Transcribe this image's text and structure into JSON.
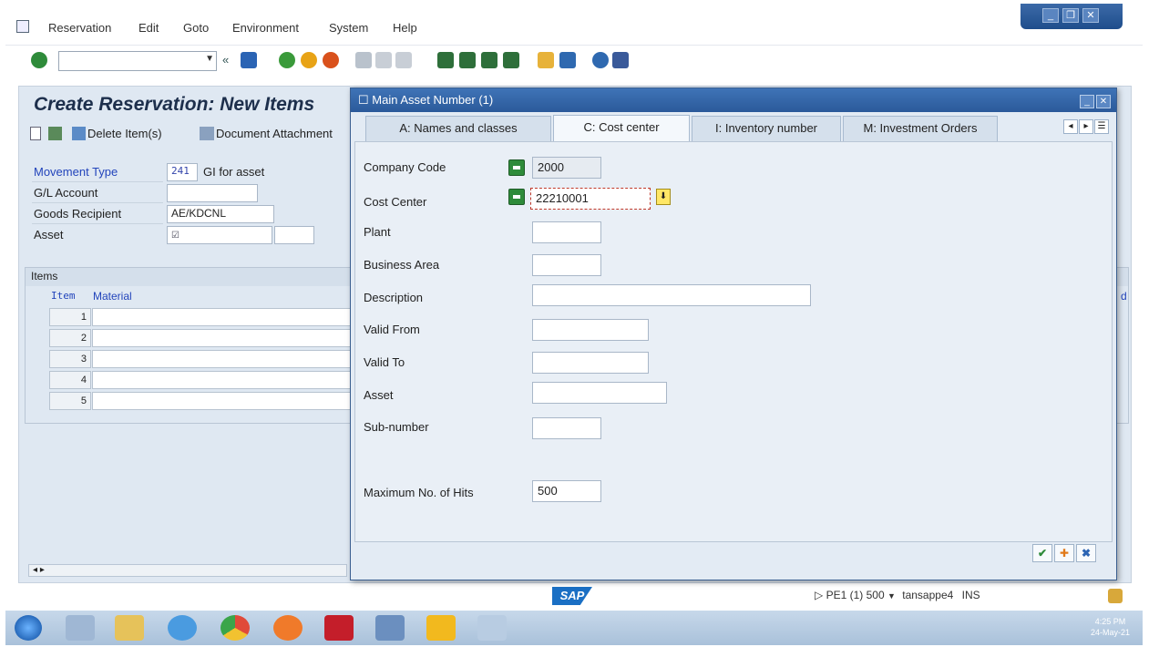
{
  "menubar": {
    "items": [
      "Reservation",
      "Edit",
      "Goto",
      "Environment",
      "System",
      "Help"
    ]
  },
  "toolbar": {
    "command_value": "",
    "icons": [
      "enter-icon",
      "save-icon",
      "back-icon",
      "exit-icon",
      "cancel-icon",
      "print-icon",
      "find-icon",
      "find-next-icon",
      "first-page-icon",
      "previous-page-icon",
      "next-page-icon",
      "last-page-icon",
      "new-session-icon",
      "shortcut-icon",
      "help-icon",
      "customize-icon"
    ]
  },
  "main": {
    "title": "Create Reservation: New Items",
    "app_toolbar": {
      "delete_label": "Delete Item(s)",
      "attachment_label": "Document Attachment"
    },
    "fields": {
      "movement_type_label": "Movement Type",
      "movement_type_value": "241",
      "movement_type_text": "GI for asset",
      "gl_account_label": "G/L Account",
      "gl_account_value": "",
      "goods_recipient_label": "Goods Recipient",
      "goods_recipient_value": "AE/KDCNL",
      "asset_label": "Asset",
      "asset_value": ""
    },
    "items": {
      "heading": "Items",
      "col_item": "Item",
      "col_material": "Material",
      "col_right_cut": "d",
      "rows": [
        "1",
        "2",
        "3",
        "4",
        "5"
      ]
    }
  },
  "dialog": {
    "title": "Main Asset Number (1)",
    "tabs": [
      {
        "label": "A: Names and classes",
        "active": false
      },
      {
        "label": "C: Cost center",
        "active": true
      },
      {
        "label": "I: Inventory number",
        "active": false
      },
      {
        "label": "M: Investment Orders",
        "active": false
      }
    ],
    "fields": {
      "company_code_label": "Company Code",
      "company_code_value": "2000",
      "cost_center_label": "Cost Center",
      "cost_center_value": "22210001",
      "plant_label": "Plant",
      "plant_value": "",
      "business_area_label": "Business Area",
      "business_area_value": "",
      "description_label": "Description",
      "description_value": "",
      "valid_from_label": "Valid From",
      "valid_from_value": "",
      "valid_to_label": "Valid To",
      "valid_to_value": "",
      "asset_label": "Asset",
      "asset_value": "",
      "subnumber_label": "Sub-number",
      "subnumber_value": "",
      "max_hits_label": "Maximum No. of Hits",
      "max_hits_value": "500"
    },
    "footer_buttons": [
      "continue-icon",
      "multiple-selection-icon",
      "cancel-icon"
    ]
  },
  "status": {
    "system": "PE1 (1) 500",
    "server": "tansappe4",
    "mode": "INS"
  },
  "taskbar": {
    "time": "4:25 PM",
    "date": "24-May-21"
  },
  "colors": {
    "title_bar": "#2b5a9a",
    "work_bg": "#dfe8f2",
    "match_code_green": "#2e8b3a",
    "label_blue": "#2244bb"
  }
}
